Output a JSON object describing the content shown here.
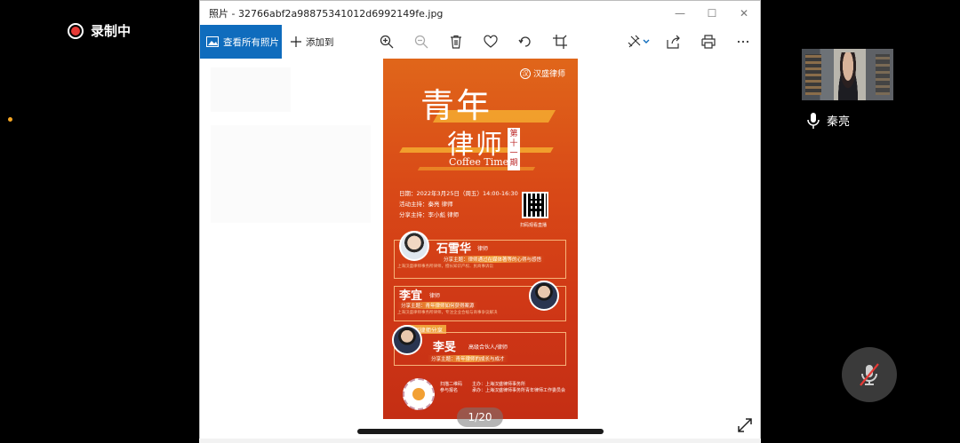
{
  "recording": {
    "label": "录制中",
    "color": "#e53935"
  },
  "window": {
    "title": "照片 - 32766abf2a98875341012d6992149fe.jpg",
    "controls": {
      "minimize": "—",
      "maximize": "☐",
      "close": "✕"
    }
  },
  "toolbar": {
    "view_all": "查看所有照片",
    "add_to": "添加到",
    "icons": [
      "zoom-in-icon",
      "zoom-out-icon",
      "delete-icon",
      "favorite-icon",
      "rotate-icon",
      "crop-icon",
      "edit-icon",
      "share-icon",
      "print-icon",
      "more-icon"
    ],
    "accent": "#0f6cbd"
  },
  "poster": {
    "logo": "汉盛律师",
    "logo_badge": "汉",
    "title_line1": "青年",
    "title_line2": "律师",
    "issue": "第十一期",
    "subtitle": "Coffee Time",
    "date": "日期：2022年3月25日（周五）14:00-16:30",
    "host": "活动主持：秦亮 律师",
    "moderator": "分享主持：李小彪 律师",
    "qr_label": "扫码观看直播",
    "speaker1": {
      "name": "石雪华",
      "title": "律师",
      "topic": "分享主题：律师通过在媒体著等的心得与感悟",
      "bio": "上海汉盛律师事务所律师，擅长知识产权、民商事诉讼"
    },
    "speaker2": {
      "name": "李宜",
      "title": "律师",
      "topic": "分享主题：青年律师如何获得案源",
      "bio": "上海汉盛律师事务所律师，专注企业合规与商事争议解决"
    },
    "section_head": "资深律师分享",
    "speaker3": {
      "name": "李旻",
      "title": "高级合伙人/律师",
      "topic": "分享主题：青年律师的成长与成才"
    },
    "footer_qr_label": "扫描二维码 参与报名",
    "footer_org": "主办：上海汉盛律师事务所",
    "footer_org2": "承办：上海汉盛律师事务所青年律师工作委员会",
    "colors": {
      "top": "#e0661a",
      "bottom": "#c42e14",
      "stripe": "#f3a62f"
    }
  },
  "viewer": {
    "page_indicator": "1/20"
  },
  "participant": {
    "name": "秦亮"
  }
}
